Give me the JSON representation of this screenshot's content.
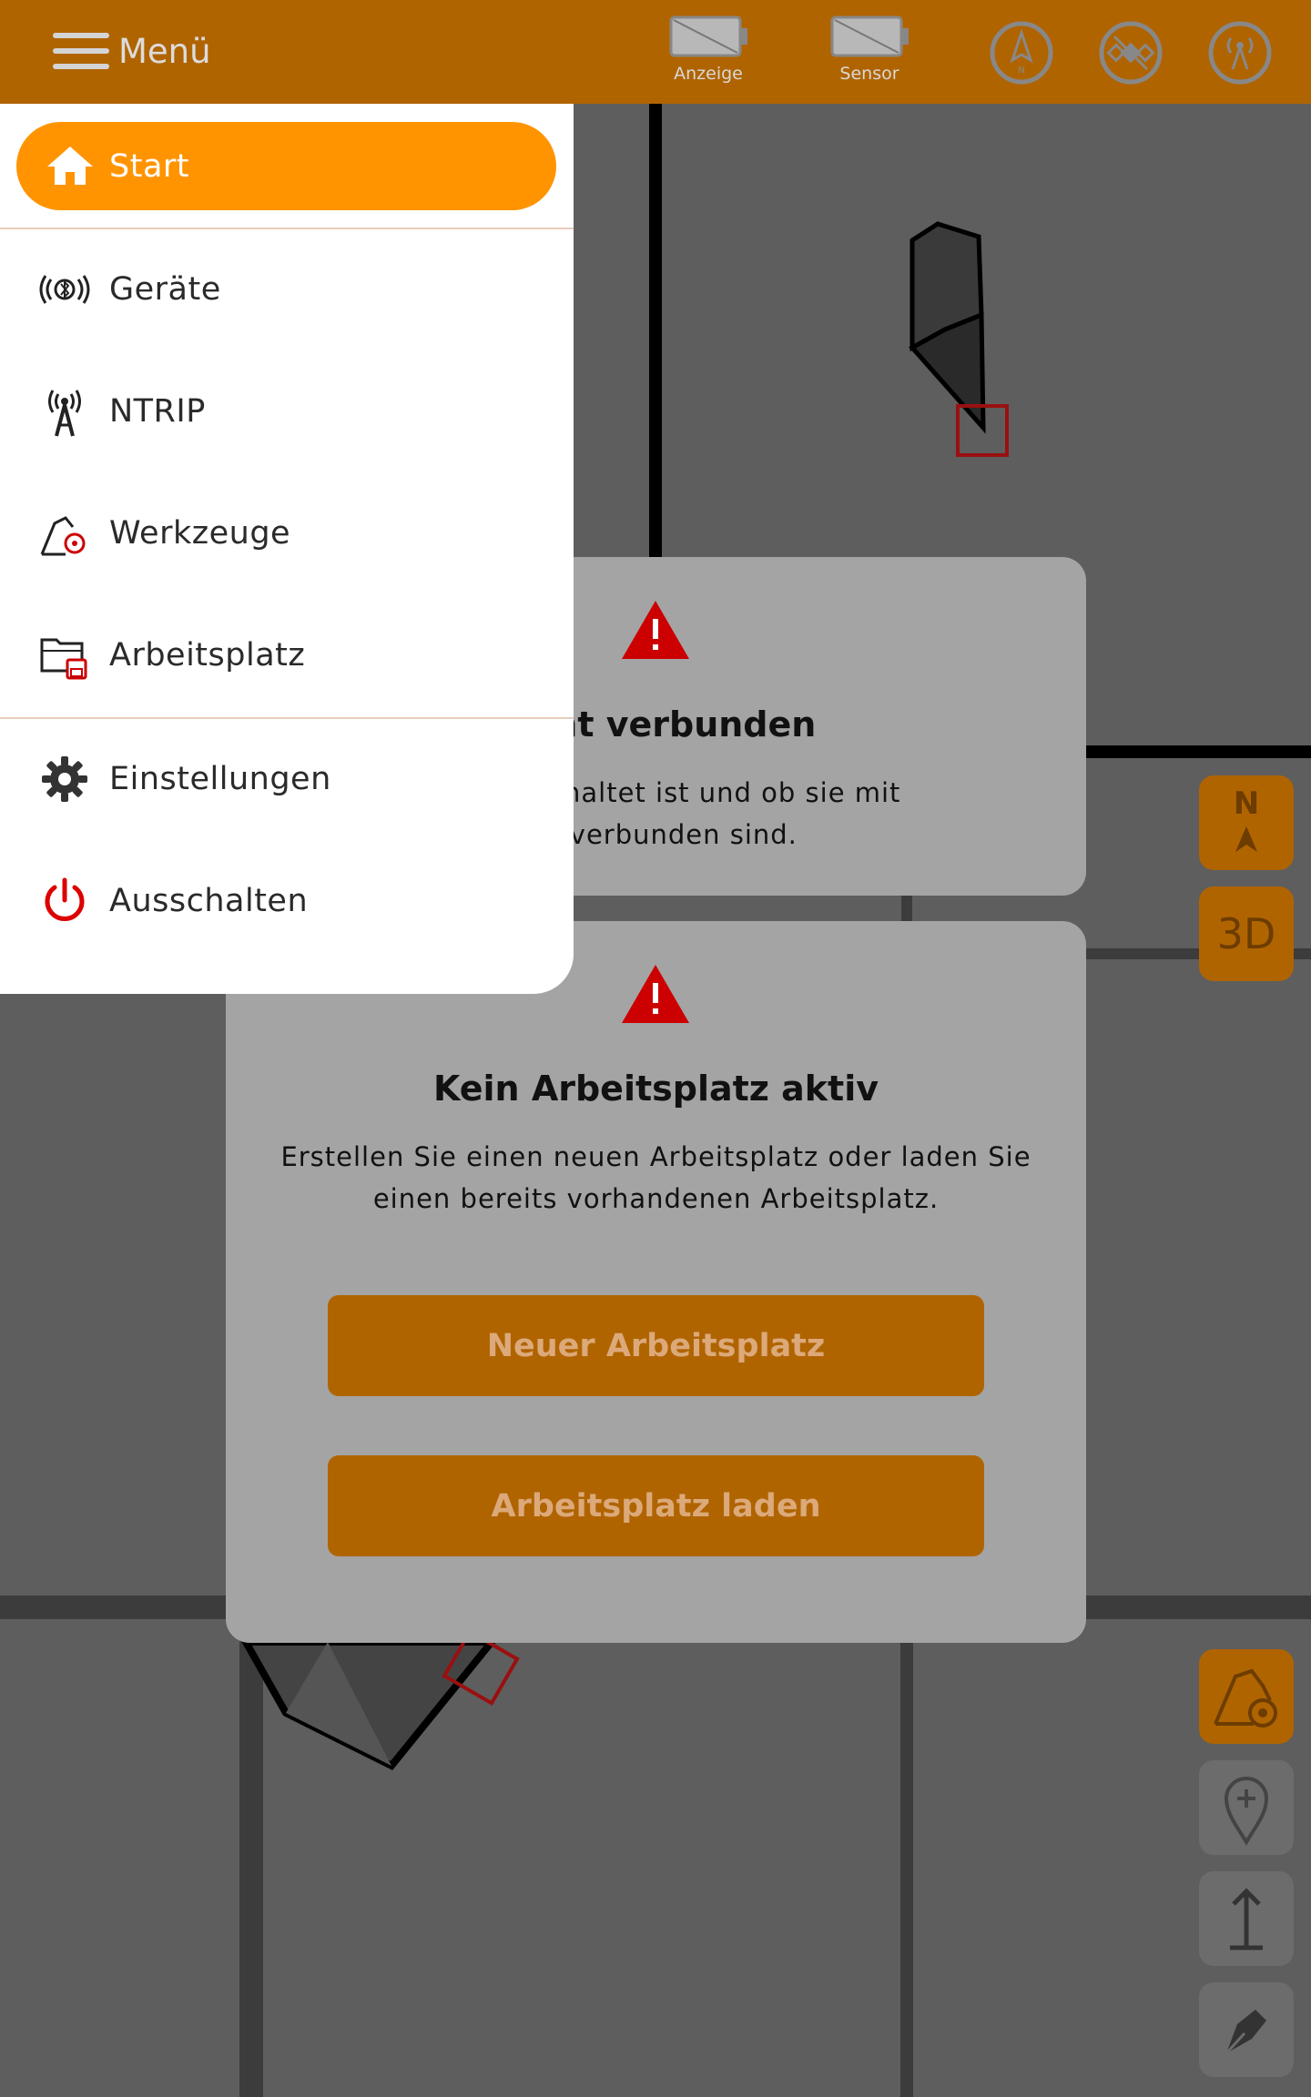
{
  "topbar": {
    "menu_label": "Menü",
    "status": [
      {
        "label": "Anzeige",
        "icon": "battery-empty-icon"
      },
      {
        "label": "Sensor",
        "icon": "battery-empty-icon"
      }
    ],
    "round_icons": [
      "compass-north-icon",
      "satellite-off-icon",
      "antenna-icon"
    ]
  },
  "drawer": {
    "items": [
      {
        "label": "Start",
        "icon": "home-icon",
        "active": true
      },
      {
        "label": "Geräte",
        "icon": "bluetooth-icon"
      },
      {
        "label": "NTRIP",
        "icon": "antenna-tower-icon"
      },
      {
        "label": "Werkzeuge",
        "icon": "excavator-bucket-gear-icon"
      },
      {
        "label": "Arbeitsplatz",
        "icon": "folder-save-icon"
      },
      {
        "label": "Einstellungen",
        "icon": "gear-icon"
      },
      {
        "label": "Ausschalten",
        "icon": "power-icon"
      }
    ]
  },
  "dialog_sensor": {
    "title": "nicht verbunden",
    "text_line1": "sor angeschaltet ist und ob sie mit",
    "text_line2": "oth verbunden sind."
  },
  "dialog_workspace": {
    "title": "Kein Arbeitsplatz aktiv",
    "text_line1": "Erstellen Sie einen neuen Arbeitsplatz oder laden Sie",
    "text_line2": "einen bereits vorhandenen Arbeitsplatz.",
    "new_button": "Neuer Arbeitsplatz",
    "load_button": "Arbeitsplatz laden"
  },
  "tools": {
    "north_label": "N",
    "view_3d_label": "3D"
  },
  "colors": {
    "accent": "#b06400",
    "active": "#ff9400",
    "dialog": "#a4a4a4",
    "warning": "#cc0000"
  }
}
